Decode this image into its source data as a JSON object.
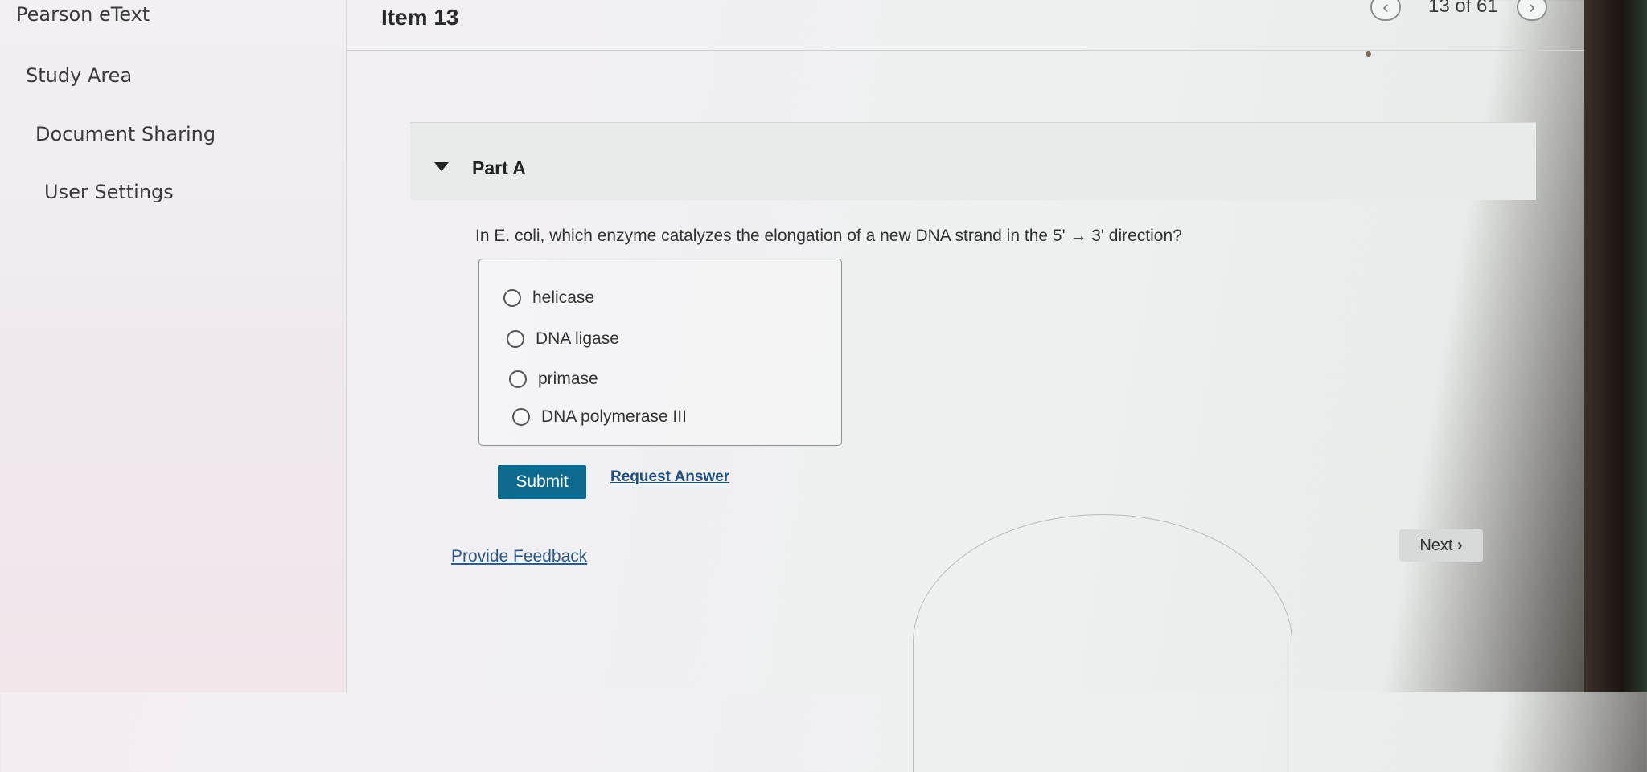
{
  "sidebar": {
    "items": [
      {
        "label": "Pearson eText"
      },
      {
        "label": "Study Area"
      },
      {
        "label": "Document Sharing"
      },
      {
        "label": "User Settings"
      }
    ]
  },
  "header": {
    "title": "Item 13",
    "counter": "13 of 61",
    "prev_icon": "chevron-left-icon",
    "next_icon": "chevron-right-icon"
  },
  "part": {
    "label": "Part A",
    "question": "In E. coli, which enzyme catalyzes the elongation of a new DNA strand in the 5' → 3' direction?",
    "choices": [
      {
        "label": "helicase"
      },
      {
        "label": "DNA ligase"
      },
      {
        "label": "primase"
      },
      {
        "label": "DNA polymerase III"
      }
    ],
    "submit_label": "Submit",
    "request_answer_label": "Request Answer"
  },
  "footer": {
    "feedback_label": "Provide Feedback",
    "next_label": "Next"
  },
  "colors": {
    "submit_bg": "#0b6a8e",
    "link": "#2d5a88"
  }
}
